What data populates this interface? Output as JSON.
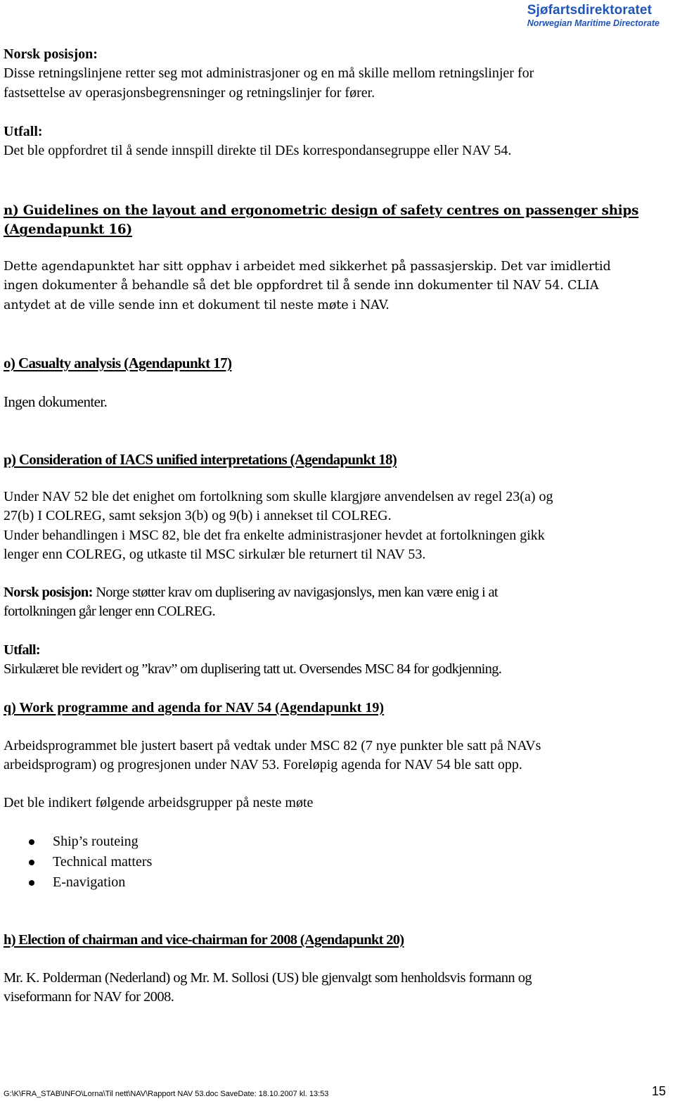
{
  "header": {
    "brand_name": "Sjøfartsdirektoratet",
    "brand_subtitle": "Norwegian  Maritime Directorate",
    "brand_color": "#1f55b8"
  },
  "sections": {
    "intro": {
      "norsk_label": "Norsk posisjon:",
      "norsk_lines": [
        "Disse retningslinjene retter seg mot administrasjoner og en må skille mellom retningslinjer for",
        "fastsettelse av operasjonsbegrensninger og retningslinjer for fører."
      ],
      "utfall_label": "Utfall:",
      "utfall_text": "Det ble oppfordret til å sende innspill direkte til DEs korrespondansegruppe eller NAV 54."
    },
    "n": {
      "heading_lines": [
        "n) Guidelines on the layout and ergonometric design of safety centres on passenger ships",
        "(Agendapunkt 16)"
      ],
      "body_lines": [
        "Dette agendapunktet har sitt opphav i arbeidet med sikkerhet på passasjerskip. Det var imidlertid",
        "ingen dokumenter å behandle så det ble oppfordret til å sende inn dokumenter til NAV 54. CLIA",
        "antydet at de ville sende inn et dokument til neste møte i NAV."
      ]
    },
    "o": {
      "heading": "o) Casualty analysis (Agendapunkt 17)",
      "body": "Ingen dokumenter."
    },
    "p": {
      "heading": "p) Consideration of IACS unified interpretations (Agendapunkt 18)",
      "body_lines": [
        "Under NAV 52 ble det enighet om fortolkning som skulle klargjøre anvendelsen av regel 23(a) og",
        "27(b) I COLREG, samt seksjon 3(b) og 9(b) i annekset til COLREG.",
        "Under behandlingen i MSC 82, ble det fra enkelte administrasjoner hevdet at fortolkningen gikk",
        "lenger enn COLREG, og utkaste til MSC sirkulær ble returnert til NAV 53."
      ],
      "norsk_label": "Norsk posisjon:",
      "norsk_text_line1": " Norge støtter krav om duplisering av navigasjonslys, men kan være enig i at",
      "norsk_text_line2": "fortolkningen går lenger enn COLREG.",
      "utfall_label": "Utfall:",
      "utfall_text": "Sirkulæret ble revidert og ”krav” om duplisering tatt ut. Oversendes MSC 84 for godkjenning."
    },
    "q": {
      "heading": "q) Work programme and agenda for NAV 54 (Agendapunkt 19)",
      "body_lines": [
        "Arbeidsprogrammet ble justert basert på vedtak under MSC 82 (7 nye punkter ble satt på NAVs",
        "arbeidsprogram) og progresjonen under NAV 53. Foreløpig agenda for NAV 54 ble satt opp."
      ],
      "groups_intro": "Det ble indikert følgende arbeidsgrupper på neste møte",
      "groups": [
        "Ship’s routeing",
        "Technical matters",
        "E-navigation"
      ]
    },
    "h": {
      "heading": "h) Election of chairman and vice-chairman for 2008 (Agendapunkt 20)",
      "body_lines": [
        "Mr. K. Polderman (Nederland) og Mr. M. Sollosi (US) ble gjenvalgt som henholdsvis formann og",
        "viseformann for NAV for 2008."
      ]
    }
  },
  "footer": {
    "path": "G:\\K\\FRA_STAB\\INFO\\Lorna\\Til nett\\NAV\\Rapport NAV 53.doc  SaveDate: 18.10.2007 kl. 13:53",
    "page_number": "15"
  }
}
